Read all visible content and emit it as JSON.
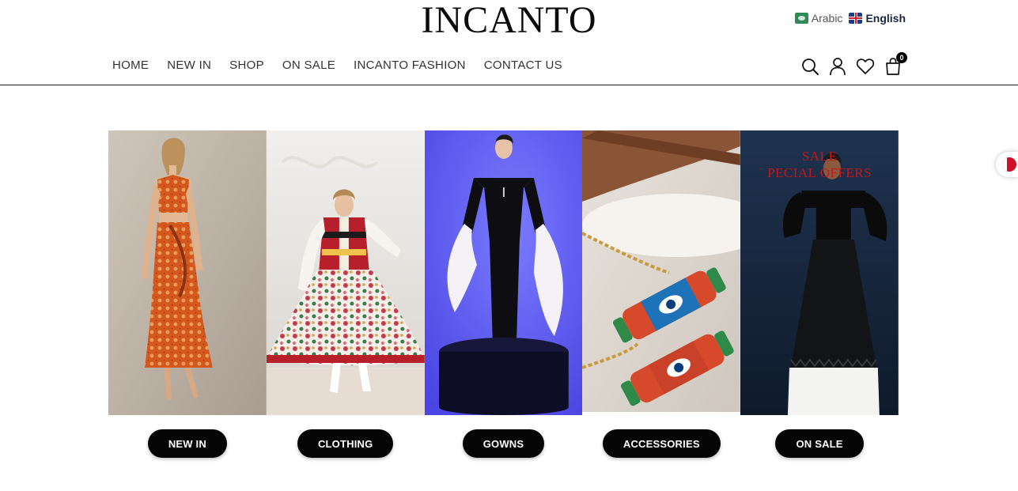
{
  "header": {
    "logo": "INCANTO",
    "languages": [
      {
        "label": "Arabic",
        "icon": "saudi-flag-icon"
      },
      {
        "label": "English",
        "icon": "uk-flag-icon"
      }
    ],
    "cart_count": "0"
  },
  "nav": {
    "items": [
      "HOME",
      "NEW IN",
      "SHOP",
      "ON SALE",
      "INCANTO FASHION",
      "CONTACT US"
    ]
  },
  "icons": [
    "search-icon",
    "user-icon",
    "heart-icon",
    "shopping-bag-icon"
  ],
  "categories": [
    {
      "label": "NEW IN",
      "image": "orange-paisley-dress"
    },
    {
      "label": "CLOTHING",
      "image": "embroidered-floral-outfit"
    },
    {
      "label": "GOWNS",
      "image": "black-gown-white-ruffles"
    },
    {
      "label": "ACCESSORIES",
      "image": "enamel-eye-bracelets"
    },
    {
      "label": "ON SALE",
      "image": "black-off-shoulder-gown",
      "overlay_lines": [
        "SALE",
        "PECIAL OFFERS"
      ]
    }
  ],
  "colors": {
    "button_bg": "#050505",
    "button_text": "#ffffff",
    "sale_text": "#c2161b",
    "gown_backdrop": "#5a54ee"
  }
}
